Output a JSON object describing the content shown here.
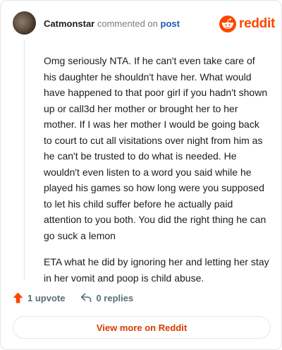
{
  "header": {
    "username": "Catmonstar",
    "action_text": "commented on",
    "post_link": "post",
    "brand_word": "reddit"
  },
  "comment": {
    "paragraphs": [
      "Omg seriously NTA. If he can't even take care of his daughter he shouldn't have her. What would have happened to that poor girl if you hadn't shown up or call3d her mother or brought her to her mother. If I was her mother I would be going back to court to cut all visitations over night from him as he can't be trusted to do what is needed. He wouldn't even listen to a word you said while he played his games so how long were you supposed to let his child suffer before he actually paid attention to you both. You did the right thing he can go suck a lemon",
      "ETA what he did by ignoring her and letting her stay in her vomit and poop is child abuse."
    ]
  },
  "actions": {
    "upvote_label": "1 upvote",
    "replies_label": "0 replies"
  },
  "footer": {
    "view_more_label": "View more on Reddit"
  },
  "colors": {
    "brand": "#ff4500",
    "link": "#1a5ab7",
    "view_more": "#d93a00"
  },
  "icons": {
    "upvote": "upvote-arrow-icon",
    "reply": "reply-arrow-icon",
    "logo": "reddit-snoo-icon"
  }
}
